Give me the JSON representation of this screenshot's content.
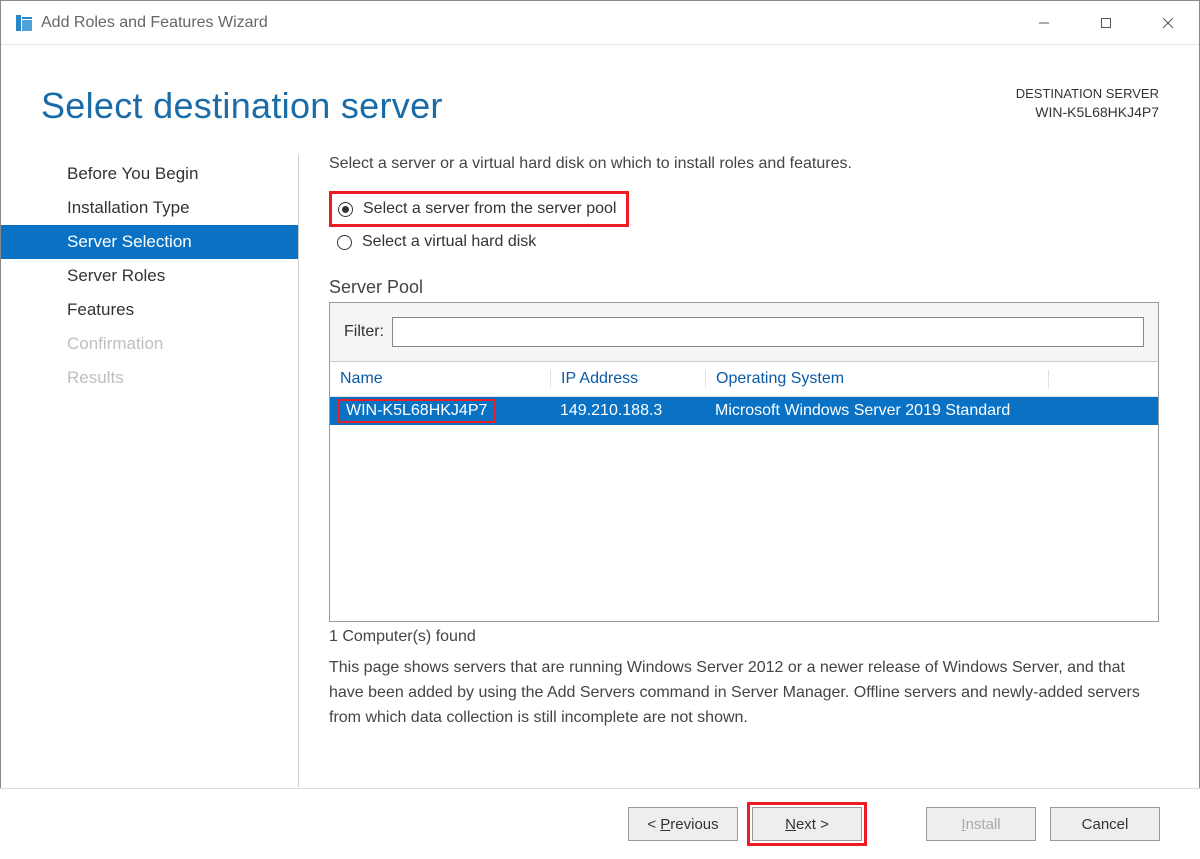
{
  "window": {
    "title": "Add Roles and Features Wizard"
  },
  "header": {
    "page_title": "Select destination server",
    "destination_label": "DESTINATION SERVER",
    "destination_value": "WIN-K5L68HKJ4P7"
  },
  "sidebar": {
    "items": [
      {
        "label": "Before You Begin",
        "state": "normal"
      },
      {
        "label": "Installation Type",
        "state": "normal"
      },
      {
        "label": "Server Selection",
        "state": "selected"
      },
      {
        "label": "Server Roles",
        "state": "normal"
      },
      {
        "label": "Features",
        "state": "normal"
      },
      {
        "label": "Confirmation",
        "state": "disabled"
      },
      {
        "label": "Results",
        "state": "disabled"
      }
    ]
  },
  "main": {
    "instruction": "Select a server or a virtual hard disk on which to install roles and features.",
    "radios": {
      "option1": "Select a server from the server pool",
      "option2": "Select a virtual hard disk"
    },
    "pool_label": "Server Pool",
    "filter_label": "Filter:",
    "filter_value": "",
    "columns": {
      "name": "Name",
      "ip": "IP Address",
      "os": "Operating System"
    },
    "rows": [
      {
        "name": "WIN-K5L68HKJ4P7",
        "ip": "149.210.188.3",
        "os": "Microsoft Windows Server 2019 Standard"
      }
    ],
    "count_text": "1 Computer(s) found",
    "description": "This page shows servers that are running Windows Server 2012 or a newer release of Windows Server, and that have been added by using the Add Servers command in Server Manager. Offline servers and newly-added servers from which data collection is still incomplete are not shown."
  },
  "footer": {
    "previous": "< Previous",
    "next": "Next >",
    "install": "Install",
    "cancel": "Cancel"
  }
}
